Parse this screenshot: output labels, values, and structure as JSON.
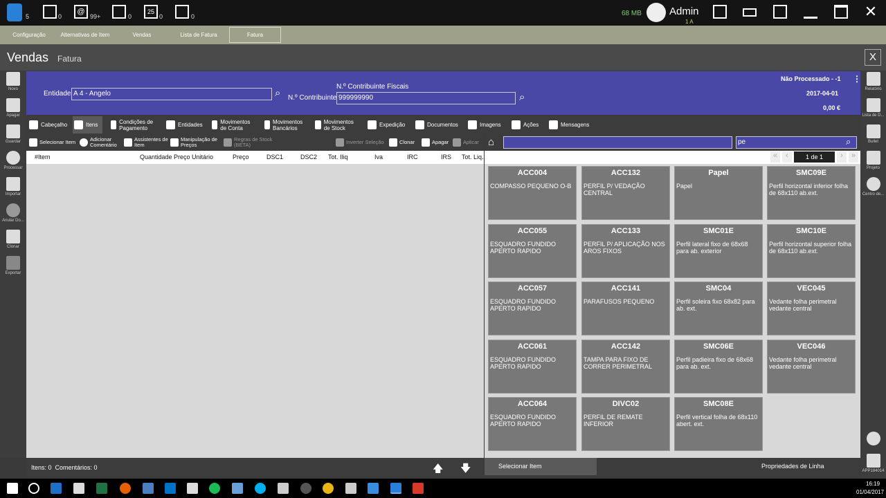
{
  "top": {
    "counts": [
      "5",
      "0",
      "99+",
      "0",
      "0",
      "0"
    ],
    "memory": "68 MB",
    "user": "Admin",
    "user_sub": "1 A"
  },
  "nav": [
    "Configuração",
    "Alternativas de Item",
    "Vendas",
    "Lista de Fatura",
    "Fatura"
  ],
  "title": {
    "main": "Vendas",
    "sub": "Fatura"
  },
  "left_actions": [
    "Novo",
    "Apagar",
    "Guardar",
    "Processar",
    "Importar",
    "Anular Do...",
    "Clonar",
    "Exportar"
  ],
  "right_actions": [
    "Relatório",
    "Lista de D...",
    "Bullet",
    "Projeto",
    "Centro de...",
    "APP184014"
  ],
  "header": {
    "entidade_label": "Entidade",
    "entidade_value": "A 4 - Angelo",
    "nc_label": "N.º Contribuinte",
    "ncf_label": "N.º Contribuinte Fiscais",
    "ncf_value": "999999990",
    "status": "Não Processado - -1",
    "date": "2017-04-01",
    "total": "0,00 €"
  },
  "tabs": [
    {
      "label": "Cabeçalho"
    },
    {
      "label": "Itens"
    },
    {
      "label": "Condições de Pagamento"
    },
    {
      "label": "Entidades"
    },
    {
      "label": "Movimentos de Conta"
    },
    {
      "label": "Movimentos Bancários"
    },
    {
      "label": "Movimentos de Stock"
    },
    {
      "label": "Expedição"
    },
    {
      "label": "Documentos"
    },
    {
      "label": "Imagens"
    },
    {
      "label": "Ações"
    },
    {
      "label": "Mensagens"
    }
  ],
  "tools": [
    "Selecionar Item",
    "Adicionar Comentário",
    "Assistentes de Item",
    "Manipulação de Preços",
    "Regras de Stock (BETA)",
    "Inverter Seleção",
    "Clonar",
    "Apagar",
    "Aplicar"
  ],
  "columns": [
    "#Item",
    "Quantidade",
    "Preço Unitário",
    "Preço",
    "DSC1",
    "DSC2",
    "Tot. Iliq",
    "Iva",
    "IRC",
    "IRS",
    "Tot. Liq."
  ],
  "footer": {
    "summary": "Itens: 0  Comentários: 0"
  },
  "search": {
    "path": "",
    "query": "pe"
  },
  "pager": {
    "label": "1 de 1"
  },
  "cards": [
    {
      "code": "ACC004",
      "desc": "COMPASSO PEQUENO O-B"
    },
    {
      "code": "ACC132",
      "desc": "PERFIL P/ VEDAÇÃO CENTRAL"
    },
    {
      "code": "Papel",
      "desc": "Papel"
    },
    {
      "code": "SMC09E",
      "desc": "Perfil horizontal inferior folha de 68x110 ab.ext."
    },
    {
      "code": "ACC055",
      "desc": "ESQUADRO FUNDIDO APERTO RAPIDO"
    },
    {
      "code": "ACC133",
      "desc": "PERFIL P/ APLICAÇÃO NOS AROS FIXOS"
    },
    {
      "code": "SMC01E",
      "desc": "Perfil lateral fixo de 68x68 para ab. exterior"
    },
    {
      "code": "SMC10E",
      "desc": "Perfil horizontal superior folha de 68x110 ab.ext."
    },
    {
      "code": "ACC057",
      "desc": "ESQUADRO FUNDIDO APERTO RAPIDO"
    },
    {
      "code": "ACC141",
      "desc": "PARAFUSOS PEQUENO"
    },
    {
      "code": "SMC04",
      "desc": "Perfil soleira fixo 68x82 para ab. ext."
    },
    {
      "code": "VEC045",
      "desc": "Vedante folha perimetral vedante central"
    },
    {
      "code": "ACC061",
      "desc": "ESQUADRO FUNDIDO APERTO RAPIDO"
    },
    {
      "code": "ACC142",
      "desc": "TAMPA PARA FIXO DE CORRER PERIMETRAL"
    },
    {
      "code": "SMC06E",
      "desc": "Perfil padieira fixo de 68x68 para ab. ext."
    },
    {
      "code": "VEC046",
      "desc": "Vedante folha perimetral vedante central"
    },
    {
      "code": "ACC064",
      "desc": "ESQUADRO FUNDIDO APERTO RAPIDO"
    },
    {
      "code": "DIVC02",
      "desc": "PERFIL DE REMATE INFERIOR"
    },
    {
      "code": "SMC08E",
      "desc": "Perfil vertical folha de 68x110 abert. ext."
    }
  ],
  "right_footer": {
    "select": "Selecionar Item",
    "props": "Propriedades de Linha"
  },
  "clock": {
    "time": "16:19",
    "date": "01/04/2017"
  }
}
